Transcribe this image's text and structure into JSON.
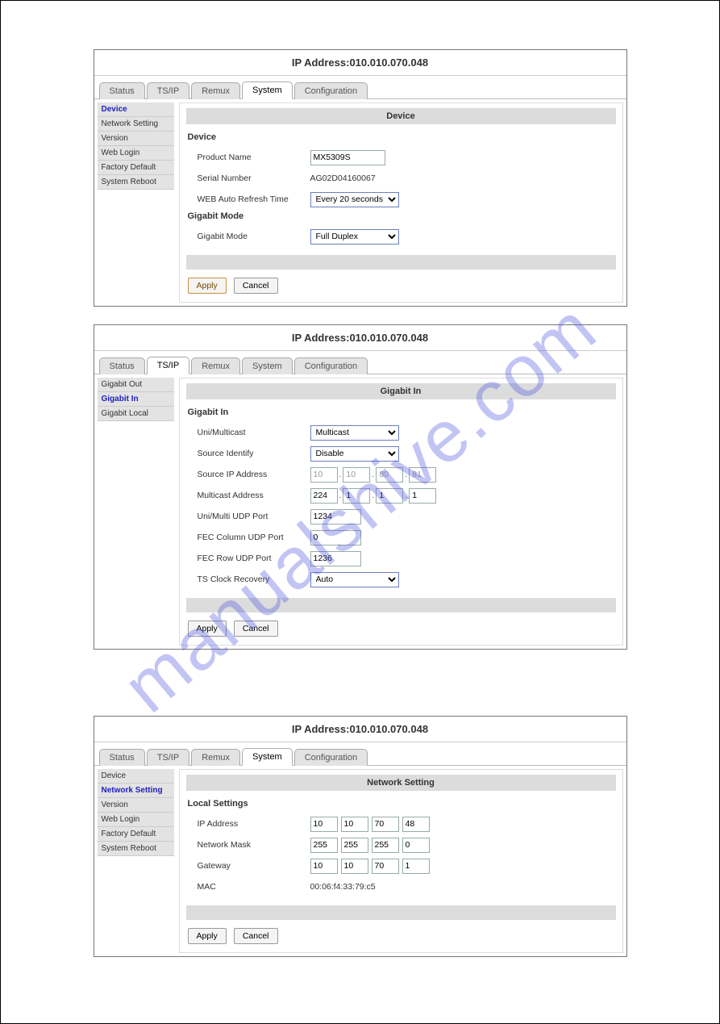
{
  "watermark": "manualshive.com",
  "common": {
    "ip_label_prefix": "IP Address:",
    "ip_value": "010.010.070.048",
    "apply": "Apply",
    "cancel": "Cancel"
  },
  "tabs": {
    "status": "Status",
    "tsip": "TS/IP",
    "remux": "Remux",
    "system": "System",
    "configuration": "Configuration"
  },
  "panel1": {
    "side": {
      "device": "Device",
      "network_setting": "Network Setting",
      "version": "Version",
      "web_login": "Web Login",
      "factory_default": "Factory Default",
      "system_reboot": "System Reboot"
    },
    "header": "Device",
    "sec_device": "Device",
    "product_name_label": "Product Name",
    "product_name_value": "MX5309S",
    "serial_number_label": "Serial Number",
    "serial_number_value": "AG02D04160067",
    "refresh_label": "WEB Auto Refresh Time",
    "refresh_value": "Every 20 seconds",
    "sec_gigabit": "Gigabit Mode",
    "gigabit_label": "Gigabit Mode",
    "gigabit_value": "Full Duplex"
  },
  "panel2": {
    "side": {
      "gigabit_out": "Gigabit Out",
      "gigabit_in": "Gigabit In",
      "gigabit_local": "Gigabit Local"
    },
    "header": "Gigabit In",
    "sec": "Gigabit In",
    "uni_multi_label": "Uni/Multicast",
    "uni_multi_value": "Multicast",
    "source_identify_label": "Source Identify",
    "source_identify_value": "Disable",
    "source_ip_label": "Source IP Address",
    "source_ip": {
      "a": "10",
      "b": "10",
      "c": "80",
      "d": "81"
    },
    "multicast_label": "Multicast Address",
    "multicast": {
      "a": "224",
      "b": "1",
      "c": "1",
      "d": "1"
    },
    "udp_port_label": "Uni/Multi UDP Port",
    "udp_port_value": "1234",
    "fec_col_label": "FEC Column UDP Port",
    "fec_col_value": "0",
    "fec_row_label": "FEC Row UDP Port",
    "fec_row_value": "1236",
    "ts_clock_label": "TS Clock Recovery",
    "ts_clock_value": "Auto"
  },
  "panel3": {
    "side": {
      "device": "Device",
      "network_setting": "Network Setting",
      "version": "Version",
      "web_login": "Web Login",
      "factory_default": "Factory Default",
      "system_reboot": "System Reboot"
    },
    "header": "Network Setting",
    "sec": "Local Settings",
    "ip_label": "IP Address",
    "ip": {
      "a": "10",
      "b": "10",
      "c": "70",
      "d": "48"
    },
    "mask_label": "Network Mask",
    "mask": {
      "a": "255",
      "b": "255",
      "c": "255",
      "d": "0"
    },
    "gateway_label": "Gateway",
    "gateway": {
      "a": "10",
      "b": "10",
      "c": "70",
      "d": "1"
    },
    "mac_label": "MAC",
    "mac_value": "00:06:f4:33:79:c5"
  }
}
